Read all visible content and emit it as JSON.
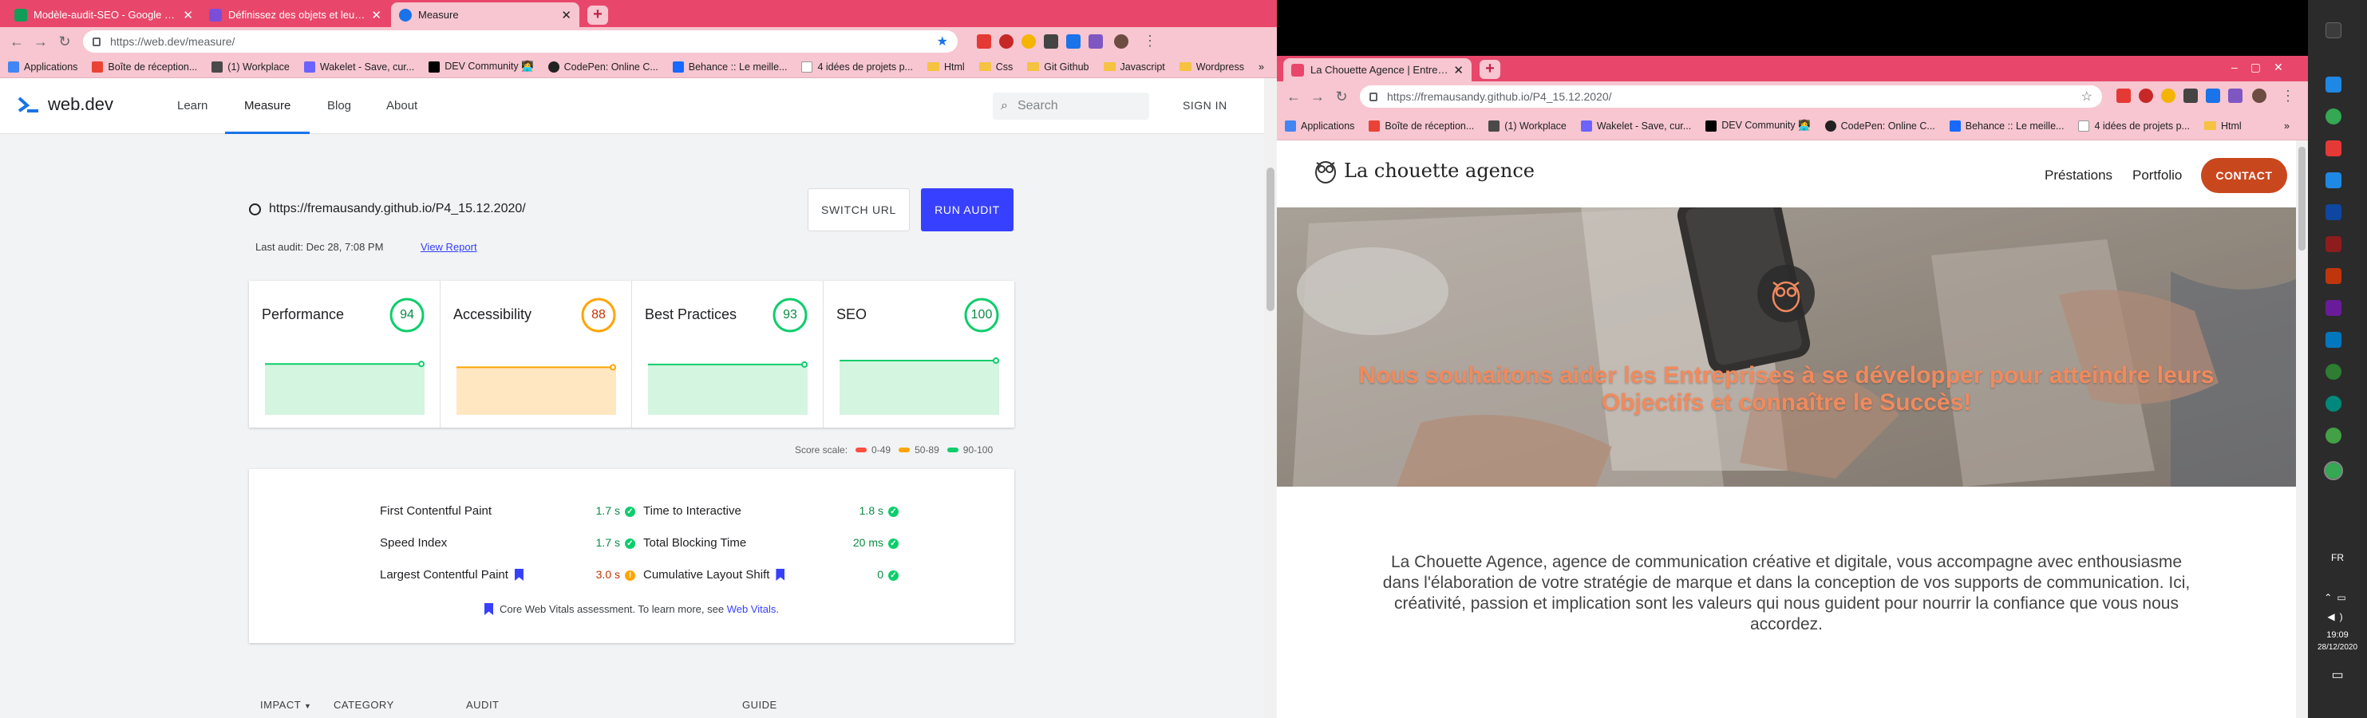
{
  "left_window": {
    "tabs": [
      {
        "title": "Modèle-audit-SEO - Google Shee",
        "color": "#0f9d58"
      },
      {
        "title": "Définissez des objets et leurs att",
        "color": "#7b4ed9"
      },
      {
        "title": "Measure",
        "color": "#1a73e8"
      }
    ],
    "address": "https://web.dev/measure/",
    "bookmarks": [
      "Applications",
      "Boîte de réception...",
      "(1) Workplace",
      "Wakelet - Save, cur...",
      "DEV Community 👩‍💻",
      "CodePen: Online C...",
      "Behance :: Le meille...",
      "4 idées de projets p...",
      "Html",
      "Css",
      "Git Github",
      "Javascript",
      "Wordpress"
    ],
    "bookmarks_more": "»"
  },
  "webdev": {
    "logo": "web.dev",
    "nav": [
      "Learn",
      "Measure",
      "Blog",
      "About"
    ],
    "search_placeholder": "Search",
    "signin": "SIGN IN",
    "url": "https://fremausandy.github.io/P4_15.12.2020/",
    "switch_url": "SWITCH URL",
    "run_audit": "RUN AUDIT",
    "last_audit": "Last audit: Dec 28, 7:08 PM",
    "view_report": "View Report",
    "cards": [
      {
        "name": "Performance",
        "score": "94",
        "color": "#0cce6b",
        "fill": "#d4f5e0",
        "value": 94
      },
      {
        "name": "Accessibility",
        "score": "88",
        "color": "#ffa400",
        "fill": "#ffe7c2",
        "value": 88
      },
      {
        "name": "Best Practices",
        "score": "93",
        "color": "#0cce6b",
        "fill": "#d4f5e0",
        "value": 93
      },
      {
        "name": "SEO",
        "score": "100",
        "color": "#0cce6b",
        "fill": "#d4f5e0",
        "value": 100
      }
    ],
    "score_scale": "Score scale:",
    "scale": [
      {
        "label": "0-49",
        "color": "#ff4e42"
      },
      {
        "label": "50-89",
        "color": "#ffa400"
      },
      {
        "label": "90-100",
        "color": "#0cce6b"
      }
    ],
    "metrics": [
      {
        "label": "First Contentful Paint",
        "value": "1.7 s",
        "status": "ok"
      },
      {
        "label": "Speed Index",
        "value": "1.7 s",
        "status": "ok"
      },
      {
        "label": "Largest Contentful Paint",
        "value": "3.0 s",
        "status": "warn",
        "core": true
      },
      {
        "label": "Time to Interactive",
        "value": "1.8 s",
        "status": "ok"
      },
      {
        "label": "Total Blocking Time",
        "value": "20 ms",
        "status": "ok"
      },
      {
        "label": "Cumulative Layout Shift",
        "value": "0",
        "status": "ok",
        "core": true
      }
    ],
    "cwv_text": "Core Web Vitals assessment. To learn more, see",
    "cwv_link": "Web Vitals",
    "cwv_end": ".",
    "table_headers": [
      "IMPACT",
      "CATEGORY",
      "AUDIT",
      "GUIDE"
    ]
  },
  "right_window": {
    "tab_title": "La Chouette Agence | Entreprise",
    "address": "https://fremausandy.github.io/P4_15.12.2020/",
    "bookmarks": [
      "Applications",
      "Boîte de réception...",
      "(1) Workplace",
      "Wakelet - Save, cur...",
      "DEV Community 👩‍💻",
      "CodePen: Online C...",
      "Behance :: Le meille...",
      "4 idées de projets p...",
      "Html"
    ],
    "bookmarks_more": "»"
  },
  "site": {
    "logo": "La chouette agence",
    "nav": [
      "Préstations",
      "Portfolio"
    ],
    "contact": "CONTACT",
    "hero_title": "Nous souhaitons aider les Entreprises à se développer pour atteindre leurs Objectifs et connaître le Succès!",
    "intro": "La Chouette Agence, agence de communication créative et digitale, vous accompagne avec enthousiasme dans l'élaboration de votre stratégie de marque et dans la conception de vos supports de communication. Ici, créativité, passion et implication sont les valeurs qui nous guident pour nourrir la confiance que vous nous accordez."
  },
  "taskbar": {
    "lang": "FR",
    "time": "19:09",
    "date": "28/12/2020"
  }
}
